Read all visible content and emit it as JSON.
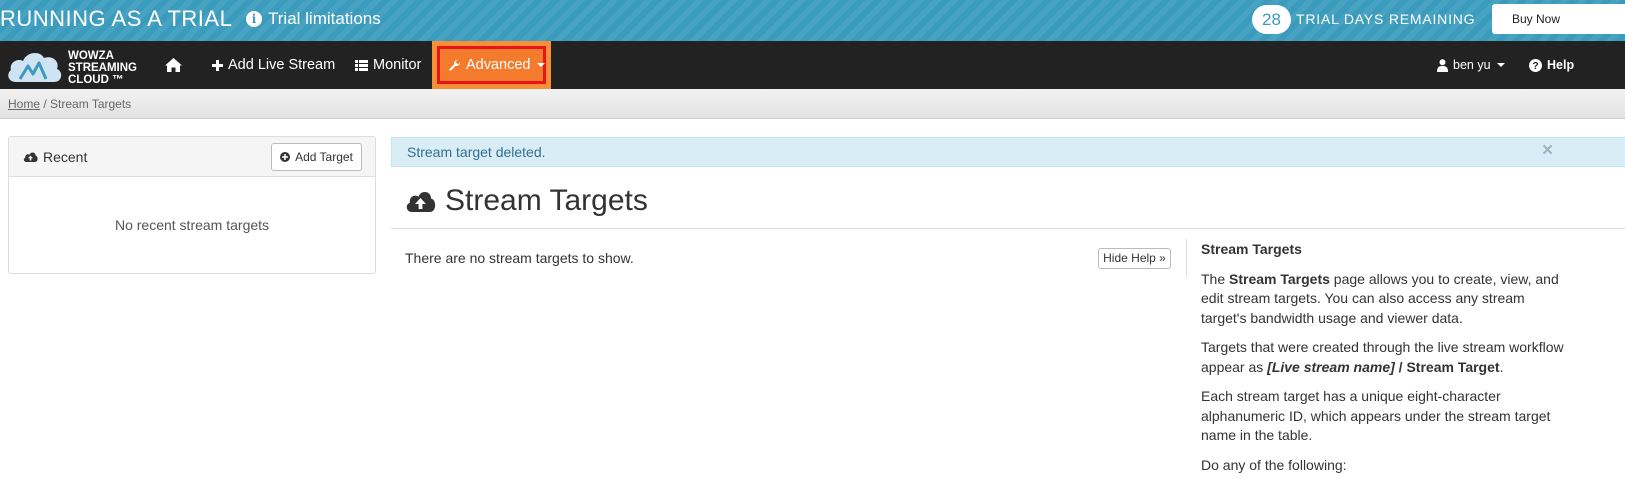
{
  "trial": {
    "title": "RUNNING AS A TRIAL",
    "limitations": "Trial limitations",
    "days_count": "28",
    "days_text": "TRIAL DAYS REMAINING",
    "buy_now": "Buy Now"
  },
  "logo": {
    "text": "WOWZA\nSTREAMING\nCLOUD ™"
  },
  "nav": {
    "add_live_stream": "Add Live Stream",
    "monitor": "Monitor",
    "advanced": "Advanced",
    "user": "ben yu",
    "help": "Help"
  },
  "breadcrumb": {
    "home": "Home",
    "separator": " / ",
    "current": "Stream Targets"
  },
  "recent": {
    "title": "Recent",
    "add_target": "Add Target",
    "empty": "No recent stream targets"
  },
  "alert": {
    "message": "Stream target deleted.",
    "close": "×"
  },
  "main": {
    "title": "Stream Targets",
    "empty": "There are no stream targets to show.",
    "hide_help": "Hide Help »"
  },
  "help": {
    "heading": "Stream Targets",
    "p1_a": "The ",
    "p1_b": "Stream Targets",
    "p1_c": " page allows you to create, view, and edit stream targets. You can also access any stream target's bandwidth usage and viewer data.",
    "p2_a": "Targets that were created through the live stream workflow appear as ",
    "p2_b": "[Live stream name]",
    "p2_c": " / ",
    "p2_d": "Stream Target",
    "p2_e": ".",
    "p3": "Each stream target has a unique eight-character alphanumeric ID, which appears under the stream target name in the table.",
    "p4": "Do any of the following:"
  },
  "colors": {
    "trial_bar": "#3a9bbd",
    "navbar": "#222222",
    "advanced_bg": "#f68f35",
    "highlight_border": "#e8141a",
    "alert_bg": "#d9edf7"
  },
  "icons": [
    "info-icon",
    "home-icon",
    "plus-icon",
    "grid-icon",
    "wrench-icon",
    "user-icon",
    "question-icon",
    "cloud-upload-icon",
    "plus-circle-icon",
    "close-icon"
  ]
}
